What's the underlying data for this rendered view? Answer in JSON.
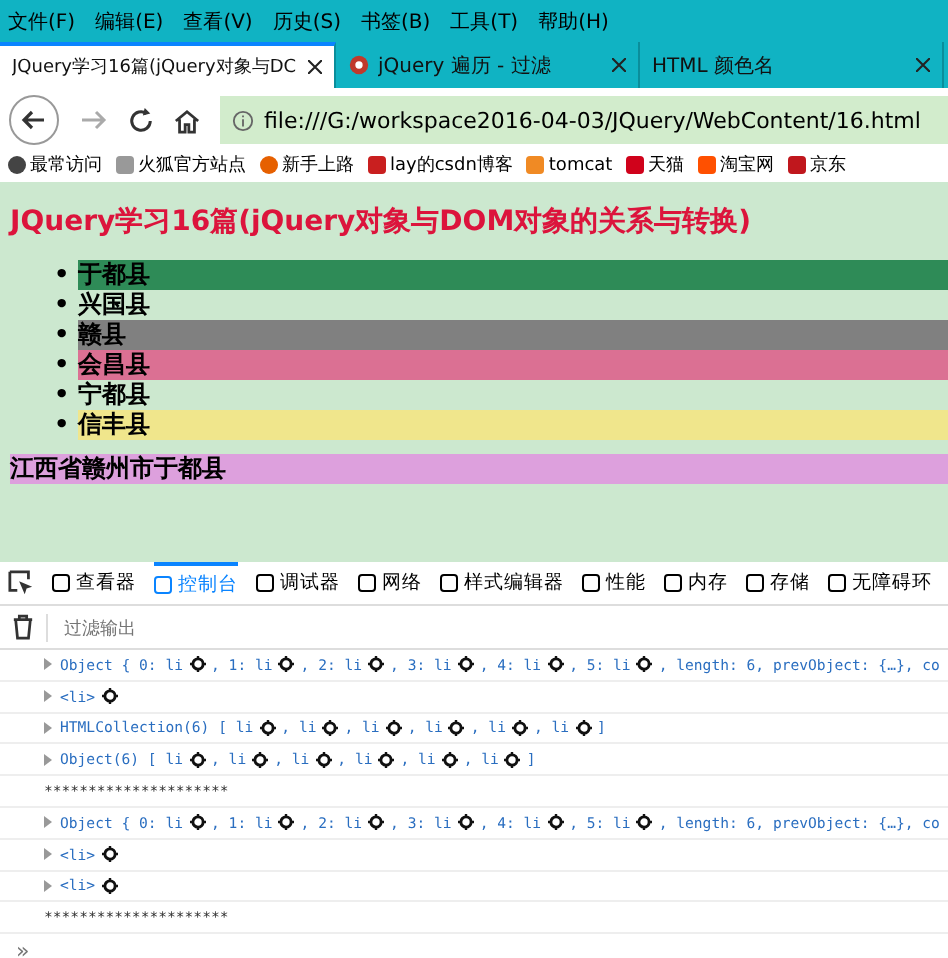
{
  "menu": [
    "文件(F)",
    "编辑(E)",
    "查看(V)",
    "历史(S)",
    "书签(B)",
    "工具(T)",
    "帮助(H)"
  ],
  "tabs": [
    {
      "title": "JQuery学习16篇(jQuery对象与DC",
      "selected": true,
      "icon": false
    },
    {
      "title": "jQuery 遍历 - 过滤",
      "selected": false,
      "icon": true
    },
    {
      "title": "HTML 颜色名",
      "selected": false,
      "icon": false
    }
  ],
  "address": "file:///G:/workspace2016-04-03/JQuery/WebContent/16.html",
  "bookmarks": [
    {
      "label": "最常访问",
      "kind": "gear"
    },
    {
      "label": "火狐官方站点",
      "kind": "folder"
    },
    {
      "label": "新手上路",
      "kind": "firefox"
    },
    {
      "label": "lay的csdn博客",
      "kind": "csdn"
    },
    {
      "label": "tomcat",
      "kind": "tomcat"
    },
    {
      "label": "天猫",
      "kind": "tmall"
    },
    {
      "label": "淘宝网",
      "kind": "taobao"
    },
    {
      "label": "京东",
      "kind": "jd"
    }
  ],
  "page": {
    "bullet": "•",
    "heading": "JQuery学习16篇(jQuery对象与DOM对象的关系与转换)",
    "items": [
      {
        "text": "于都县",
        "color": "#2e8b57"
      },
      {
        "text": "兴国县"
      },
      {
        "text": "赣县",
        "color": "#808080"
      },
      {
        "text": "会昌县",
        "color": "#db7093"
      },
      {
        "text": "宁都县"
      },
      {
        "text": "信丰县",
        "color": "#f0e68c"
      }
    ],
    "footer": {
      "text": "江西省赣州市于都县",
      "color": "#dda0dd"
    }
  },
  "devtools": {
    "tabs": [
      {
        "label": "查看器",
        "selected": false
      },
      {
        "label": "控制台",
        "selected": true
      },
      {
        "label": "调试器",
        "selected": false
      },
      {
        "label": "网络",
        "selected": false
      },
      {
        "label": "样式编辑器",
        "selected": false
      },
      {
        "label": "性能",
        "selected": false
      },
      {
        "label": "内存",
        "selected": false
      },
      {
        "label": "存储",
        "selected": false
      },
      {
        "label": "无障碍环",
        "selected": false
      }
    ],
    "filter_placeholder": "过滤输出",
    "lines": [
      {
        "kind": "log",
        "gear_end": false,
        "segments": [
          "Object { 0: li",
          ", 1: li",
          ", 2: li",
          ", 3: li",
          ", 4: li",
          ", 5: li",
          ", length: 6, prevObject: {…}, co"
        ]
      },
      {
        "kind": "log",
        "gear_end": true,
        "segments": [
          "<li>"
        ]
      },
      {
        "kind": "log",
        "gear_end": false,
        "segments": [
          "HTMLCollection(6) [ li",
          ", li",
          ", li",
          ", li",
          ", li",
          ", li",
          " ]"
        ]
      },
      {
        "kind": "log",
        "gear_end": false,
        "segments": [
          "Object(6) [ li",
          ", li",
          ", li",
          ", li",
          ", li",
          ", li",
          " ]"
        ]
      },
      {
        "kind": "separator",
        "text": "*********************"
      },
      {
        "kind": "log",
        "gear_end": false,
        "segments": [
          "Object { 0: li",
          ", 1: li",
          ", 2: li",
          ", 3: li",
          ", 4: li",
          ", 5: li",
          ", length: 6, prevObject: {…}, co"
        ]
      },
      {
        "kind": "log",
        "gear_end": true,
        "segments": [
          "<li>"
        ]
      },
      {
        "kind": "log",
        "gear_end": true,
        "segments": [
          "<li>"
        ]
      },
      {
        "kind": "separator",
        "text": "*********************"
      }
    ],
    "prompt": "»"
  }
}
